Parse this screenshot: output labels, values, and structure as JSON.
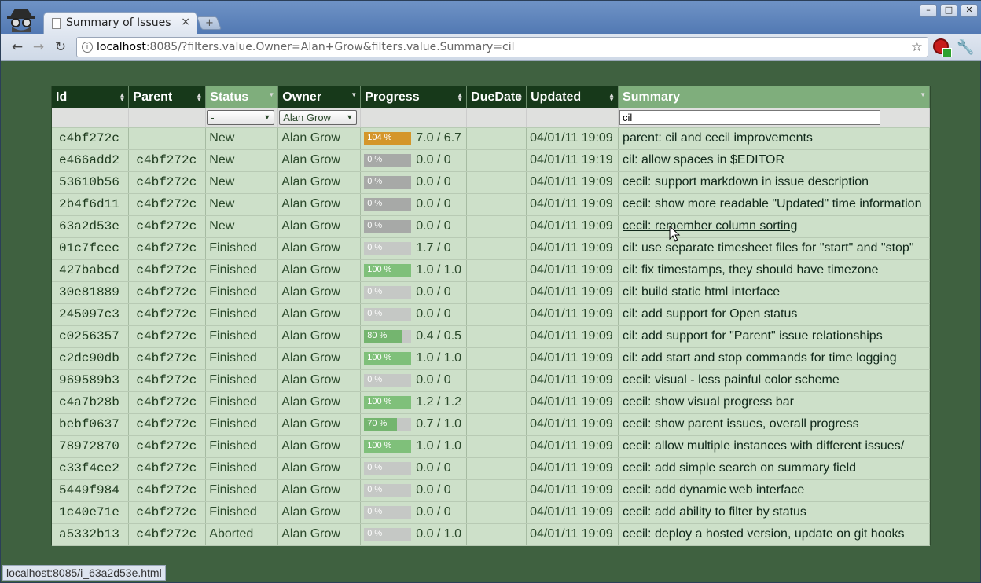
{
  "browser": {
    "tab_title": "Summary of Issues",
    "tab_close": "×",
    "new_tab": "+",
    "url_host": "localhost",
    "url_rest": ":8085/?filters.value.Owner=Alan+Grow&filters.value.Summary=cil",
    "status_url": "localhost:8085/i_63a2d53e.html",
    "minimize": "–",
    "maximize": "□",
    "close": "✕"
  },
  "table": {
    "columns": [
      "Id",
      "Parent",
      "Status",
      "Owner",
      "Progress",
      "DueDate",
      "Updated",
      "Summary"
    ],
    "filters": {
      "status": "-",
      "owner": "Alan Grow",
      "summary": "cil"
    },
    "rows": [
      {
        "id": "c4bf272c",
        "parent": "",
        "status": "New",
        "owner": "Alan Grow",
        "pct_label": "104 %",
        "pct": 104,
        "progress": "7.0 / 6.7",
        "due": "",
        "updated": "04/01/11 19:09",
        "summary": "parent: cil and cecil improvements"
      },
      {
        "id": "e466add2",
        "parent": "c4bf272c",
        "status": "New",
        "owner": "Alan Grow",
        "pct_label": "0 %",
        "pct": 0,
        "progress": "0.0 / 0",
        "due": "",
        "updated": "04/01/11 19:19",
        "summary": "cil: allow spaces in $EDITOR"
      },
      {
        "id": "53610b56",
        "parent": "c4bf272c",
        "status": "New",
        "owner": "Alan Grow",
        "pct_label": "0 %",
        "pct": 0,
        "progress": "0.0 / 0",
        "due": "",
        "updated": "04/01/11 19:09",
        "summary": "cecil: support markdown in issue description"
      },
      {
        "id": "2b4f6d11",
        "parent": "c4bf272c",
        "status": "New",
        "owner": "Alan Grow",
        "pct_label": "0 %",
        "pct": 0,
        "progress": "0.0 / 0",
        "due": "",
        "updated": "04/01/11 19:09",
        "summary": "cecil: show more readable \"Updated\" time information"
      },
      {
        "id": "63a2d53e",
        "parent": "c4bf272c",
        "status": "New",
        "owner": "Alan Grow",
        "pct_label": "0 %",
        "pct": 0,
        "progress": "0.0 / 0",
        "due": "",
        "updated": "04/01/11 19:09",
        "summary": "cecil: remember column sorting"
      },
      {
        "id": "01c7fcec",
        "parent": "c4bf272c",
        "status": "Finished",
        "owner": "Alan Grow",
        "pct_label": "0 %",
        "pct": 0,
        "progress": "1.7 / 0",
        "due": "",
        "updated": "04/01/11 19:09",
        "summary": "cil: use separate timesheet files for \"start\" and \"stop\""
      },
      {
        "id": "427babcd",
        "parent": "c4bf272c",
        "status": "Finished",
        "owner": "Alan Grow",
        "pct_label": "100 %",
        "pct": 100,
        "progress": "1.0 / 1.0",
        "due": "",
        "updated": "04/01/11 19:09",
        "summary": "cil: fix timestamps, they should have timezone"
      },
      {
        "id": "30e81889",
        "parent": "c4bf272c",
        "status": "Finished",
        "owner": "Alan Grow",
        "pct_label": "0 %",
        "pct": 0,
        "progress": "0.0 / 0",
        "due": "",
        "updated": "04/01/11 19:09",
        "summary": "cil: build static html interface"
      },
      {
        "id": "245097c3",
        "parent": "c4bf272c",
        "status": "Finished",
        "owner": "Alan Grow",
        "pct_label": "0 %",
        "pct": 0,
        "progress": "0.0 / 0",
        "due": "",
        "updated": "04/01/11 19:09",
        "summary": "cil: add support for Open status"
      },
      {
        "id": "c0256357",
        "parent": "c4bf272c",
        "status": "Finished",
        "owner": "Alan Grow",
        "pct_label": "80 %",
        "pct": 80,
        "progress": "0.4 / 0.5",
        "due": "",
        "updated": "04/01/11 19:09",
        "summary": "cil: add support for \"Parent\" issue relationships"
      },
      {
        "id": "c2dc90db",
        "parent": "c4bf272c",
        "status": "Finished",
        "owner": "Alan Grow",
        "pct_label": "100 %",
        "pct": 100,
        "progress": "1.0 / 1.0",
        "due": "",
        "updated": "04/01/11 19:09",
        "summary": "cil: add start and stop commands for time logging"
      },
      {
        "id": "969589b3",
        "parent": "c4bf272c",
        "status": "Finished",
        "owner": "Alan Grow",
        "pct_label": "0 %",
        "pct": 0,
        "progress": "0.0 / 0",
        "due": "",
        "updated": "04/01/11 19:09",
        "summary": "cecil: visual - less painful color scheme"
      },
      {
        "id": "c4a7b28b",
        "parent": "c4bf272c",
        "status": "Finished",
        "owner": "Alan Grow",
        "pct_label": "100 %",
        "pct": 100,
        "progress": "1.2 / 1.2",
        "due": "",
        "updated": "04/01/11 19:09",
        "summary": "cecil: show visual progress bar"
      },
      {
        "id": "bebf0637",
        "parent": "c4bf272c",
        "status": "Finished",
        "owner": "Alan Grow",
        "pct_label": "70 %",
        "pct": 70,
        "progress": "0.7 / 1.0",
        "due": "",
        "updated": "04/01/11 19:09",
        "summary": "cecil: show parent issues, overall progress"
      },
      {
        "id": "78972870",
        "parent": "c4bf272c",
        "status": "Finished",
        "owner": "Alan Grow",
        "pct_label": "100 %",
        "pct": 100,
        "progress": "1.0 / 1.0",
        "due": "",
        "updated": "04/01/11 19:09",
        "summary": "cecil: allow multiple instances with different issues/"
      },
      {
        "id": "c33f4ce2",
        "parent": "c4bf272c",
        "status": "Finished",
        "owner": "Alan Grow",
        "pct_label": "0 %",
        "pct": 0,
        "progress": "0.0 / 0",
        "due": "",
        "updated": "04/01/11 19:09",
        "summary": "cecil: add simple search on summary field"
      },
      {
        "id": "5449f984",
        "parent": "c4bf272c",
        "status": "Finished",
        "owner": "Alan Grow",
        "pct_label": "0 %",
        "pct": 0,
        "progress": "0.0 / 0",
        "due": "",
        "updated": "04/01/11 19:09",
        "summary": "cecil: add dynamic web interface"
      },
      {
        "id": "1c40e71e",
        "parent": "c4bf272c",
        "status": "Finished",
        "owner": "Alan Grow",
        "pct_label": "0 %",
        "pct": 0,
        "progress": "0.0 / 0",
        "due": "",
        "updated": "04/01/11 19:09",
        "summary": "cecil: add ability to filter by status"
      },
      {
        "id": "a5332b13",
        "parent": "c4bf272c",
        "status": "Aborted",
        "owner": "Alan Grow",
        "pct_label": "0 %",
        "pct": 0,
        "progress": "0.0 / 1.0",
        "due": "",
        "updated": "04/01/11 19:09",
        "summary": "cecil: deploy a hosted version, update on git hooks"
      }
    ]
  },
  "colors": {
    "page_bg": "#3f6140",
    "header_bg": "#17391a",
    "header_active": "#7fae7c",
    "row_bg": "#cde0c9",
    "bar_over": "#d4962a",
    "bar_done": "#7fc07a",
    "bar_partial": "#74b56f",
    "bar_empty_new": "#a7a9a7",
    "bar_empty_done": "#c5c8c5"
  },
  "icons": {
    "incognito": "incognito-icon",
    "back": "back-arrow-icon",
    "forward": "forward-arrow-icon",
    "reload": "reload-icon",
    "star": "star-icon",
    "wrench": "wrench-icon"
  }
}
